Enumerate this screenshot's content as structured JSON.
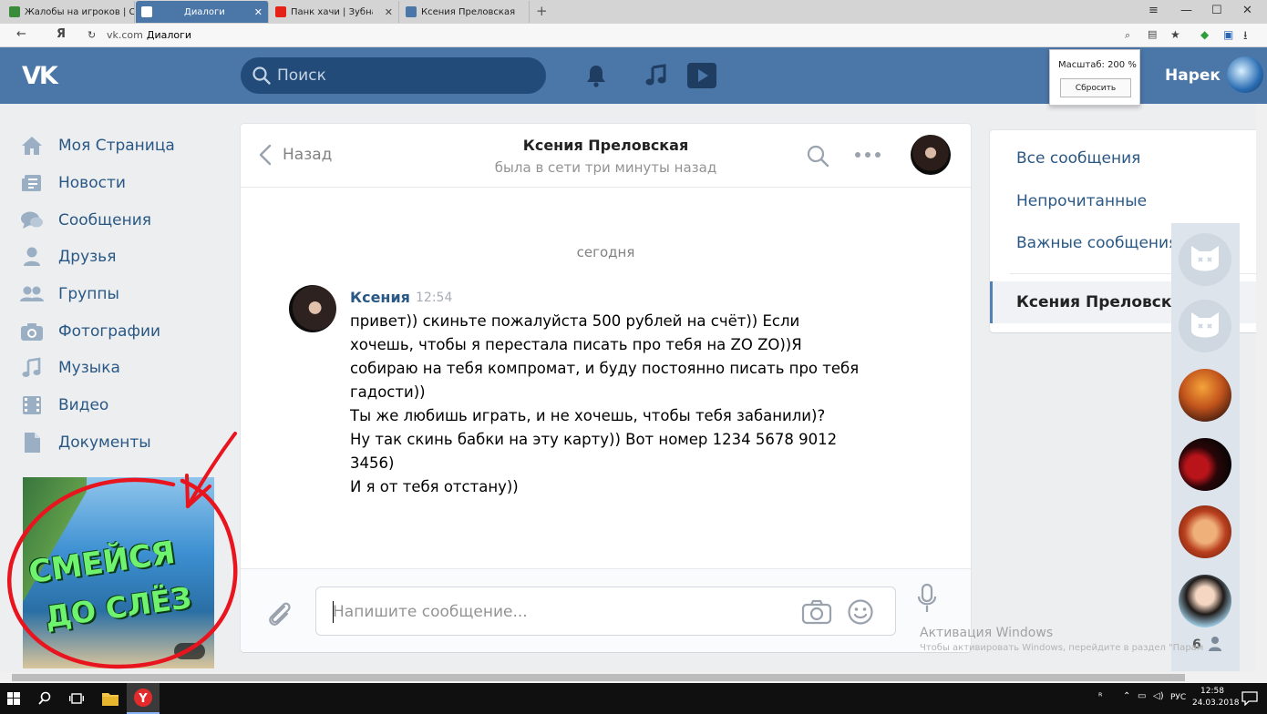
{
  "browser": {
    "tabs": [
      {
        "label": "Жалобы на игроков | Стра",
        "favicon_color": "#3a8c3a"
      },
      {
        "label": "Диалоги",
        "favicon_color": "#ffffff",
        "active": true
      },
      {
        "label": "Панк хачи | Зубная щ",
        "favicon_color": "#e62117"
      },
      {
        "label": "Ксения Преловская",
        "favicon_color": "#4a76a8"
      }
    ],
    "address": {
      "domain": "vk.com",
      "title": "Диалоги"
    },
    "zoom": {
      "label": "Масштаб: 200 %",
      "reset_button": "Сбросить"
    }
  },
  "header": {
    "logo": "VK",
    "search_placeholder": "Поиск",
    "user_name": "Нарек"
  },
  "left_menu": [
    {
      "label": "Моя Страница",
      "icon": "home-icon"
    },
    {
      "label": "Новости",
      "icon": "news-icon"
    },
    {
      "label": "Сообщения",
      "icon": "messages-icon"
    },
    {
      "label": "Друзья",
      "icon": "friend-icon"
    },
    {
      "label": "Группы",
      "icon": "groups-icon"
    },
    {
      "label": "Фотографии",
      "icon": "camera-icon"
    },
    {
      "label": "Музыка",
      "icon": "music-note-icon"
    },
    {
      "label": "Видео",
      "icon": "film-icon"
    },
    {
      "label": "Документы",
      "icon": "document-icon"
    }
  ],
  "ad": {
    "line1": "СМЕЙСЯ",
    "line2": "ДО СЛЁЗ"
  },
  "chat": {
    "back_label": "Назад",
    "peer_name": "Ксения Преловская",
    "peer_status": "была в сети три минуты назад",
    "day_separator": "сегодня",
    "message": {
      "author": "Ксения",
      "time": "12:54",
      "lines": [
        "привет)) скиньте пожалуйста 500 рублей на счёт)) Если",
        "хочешь, чтобы я перестала писать про тебя на ZO ZO))Я",
        "собираю на тебя компромат, и буду постоянно писать про тебя",
        "гадости))",
        "Ты же любишь играть, и не хочешь, чтобы тебя забанили)?",
        "Ну так скинь бабки на эту карту)) Вот номер 1234 5678 9012",
        "3456)",
        "И я от тебя отстану))"
      ]
    },
    "input_placeholder": "Напишите сообщение..."
  },
  "filters": {
    "all": "Все сообщения",
    "unread": "Непрочитанные",
    "important": "Важные сообщения",
    "active_dialog": "Ксения Преловская"
  },
  "online_friends": {
    "count": "6"
  },
  "watermark": {
    "title": "Активация Windows",
    "subtitle": "Чтобы активировать Windows, перейдите в раздел \"Парам"
  },
  "taskbar": {
    "lang": "РУС",
    "time": "12:58",
    "date": "24.03.2018"
  },
  "colors": {
    "vk_blue": "#4a76a8",
    "link": "#2a5885",
    "annotation_red": "#e8141e"
  }
}
